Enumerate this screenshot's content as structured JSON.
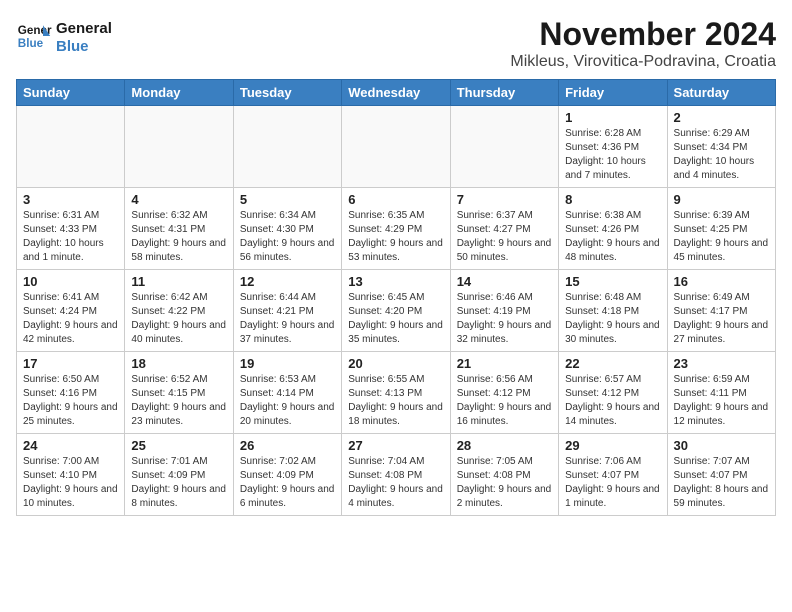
{
  "header": {
    "logo_line1": "General",
    "logo_line2": "Blue",
    "month_year": "November 2024",
    "location": "Mikleus, Virovitica-Podravina, Croatia"
  },
  "columns": [
    "Sunday",
    "Monday",
    "Tuesday",
    "Wednesday",
    "Thursday",
    "Friday",
    "Saturday"
  ],
  "weeks": [
    [
      {
        "day": "",
        "info": ""
      },
      {
        "day": "",
        "info": ""
      },
      {
        "day": "",
        "info": ""
      },
      {
        "day": "",
        "info": ""
      },
      {
        "day": "",
        "info": ""
      },
      {
        "day": "1",
        "info": "Sunrise: 6:28 AM\nSunset: 4:36 PM\nDaylight: 10 hours and 7 minutes."
      },
      {
        "day": "2",
        "info": "Sunrise: 6:29 AM\nSunset: 4:34 PM\nDaylight: 10 hours and 4 minutes."
      }
    ],
    [
      {
        "day": "3",
        "info": "Sunrise: 6:31 AM\nSunset: 4:33 PM\nDaylight: 10 hours and 1 minute."
      },
      {
        "day": "4",
        "info": "Sunrise: 6:32 AM\nSunset: 4:31 PM\nDaylight: 9 hours and 58 minutes."
      },
      {
        "day": "5",
        "info": "Sunrise: 6:34 AM\nSunset: 4:30 PM\nDaylight: 9 hours and 56 minutes."
      },
      {
        "day": "6",
        "info": "Sunrise: 6:35 AM\nSunset: 4:29 PM\nDaylight: 9 hours and 53 minutes."
      },
      {
        "day": "7",
        "info": "Sunrise: 6:37 AM\nSunset: 4:27 PM\nDaylight: 9 hours and 50 minutes."
      },
      {
        "day": "8",
        "info": "Sunrise: 6:38 AM\nSunset: 4:26 PM\nDaylight: 9 hours and 48 minutes."
      },
      {
        "day": "9",
        "info": "Sunrise: 6:39 AM\nSunset: 4:25 PM\nDaylight: 9 hours and 45 minutes."
      }
    ],
    [
      {
        "day": "10",
        "info": "Sunrise: 6:41 AM\nSunset: 4:24 PM\nDaylight: 9 hours and 42 minutes."
      },
      {
        "day": "11",
        "info": "Sunrise: 6:42 AM\nSunset: 4:22 PM\nDaylight: 9 hours and 40 minutes."
      },
      {
        "day": "12",
        "info": "Sunrise: 6:44 AM\nSunset: 4:21 PM\nDaylight: 9 hours and 37 minutes."
      },
      {
        "day": "13",
        "info": "Sunrise: 6:45 AM\nSunset: 4:20 PM\nDaylight: 9 hours and 35 minutes."
      },
      {
        "day": "14",
        "info": "Sunrise: 6:46 AM\nSunset: 4:19 PM\nDaylight: 9 hours and 32 minutes."
      },
      {
        "day": "15",
        "info": "Sunrise: 6:48 AM\nSunset: 4:18 PM\nDaylight: 9 hours and 30 minutes."
      },
      {
        "day": "16",
        "info": "Sunrise: 6:49 AM\nSunset: 4:17 PM\nDaylight: 9 hours and 27 minutes."
      }
    ],
    [
      {
        "day": "17",
        "info": "Sunrise: 6:50 AM\nSunset: 4:16 PM\nDaylight: 9 hours and 25 minutes."
      },
      {
        "day": "18",
        "info": "Sunrise: 6:52 AM\nSunset: 4:15 PM\nDaylight: 9 hours and 23 minutes."
      },
      {
        "day": "19",
        "info": "Sunrise: 6:53 AM\nSunset: 4:14 PM\nDaylight: 9 hours and 20 minutes."
      },
      {
        "day": "20",
        "info": "Sunrise: 6:55 AM\nSunset: 4:13 PM\nDaylight: 9 hours and 18 minutes."
      },
      {
        "day": "21",
        "info": "Sunrise: 6:56 AM\nSunset: 4:12 PM\nDaylight: 9 hours and 16 minutes."
      },
      {
        "day": "22",
        "info": "Sunrise: 6:57 AM\nSunset: 4:12 PM\nDaylight: 9 hours and 14 minutes."
      },
      {
        "day": "23",
        "info": "Sunrise: 6:59 AM\nSunset: 4:11 PM\nDaylight: 9 hours and 12 minutes."
      }
    ],
    [
      {
        "day": "24",
        "info": "Sunrise: 7:00 AM\nSunset: 4:10 PM\nDaylight: 9 hours and 10 minutes."
      },
      {
        "day": "25",
        "info": "Sunrise: 7:01 AM\nSunset: 4:09 PM\nDaylight: 9 hours and 8 minutes."
      },
      {
        "day": "26",
        "info": "Sunrise: 7:02 AM\nSunset: 4:09 PM\nDaylight: 9 hours and 6 minutes."
      },
      {
        "day": "27",
        "info": "Sunrise: 7:04 AM\nSunset: 4:08 PM\nDaylight: 9 hours and 4 minutes."
      },
      {
        "day": "28",
        "info": "Sunrise: 7:05 AM\nSunset: 4:08 PM\nDaylight: 9 hours and 2 minutes."
      },
      {
        "day": "29",
        "info": "Sunrise: 7:06 AM\nSunset: 4:07 PM\nDaylight: 9 hours and 1 minute."
      },
      {
        "day": "30",
        "info": "Sunrise: 7:07 AM\nSunset: 4:07 PM\nDaylight: 8 hours and 59 minutes."
      }
    ]
  ]
}
